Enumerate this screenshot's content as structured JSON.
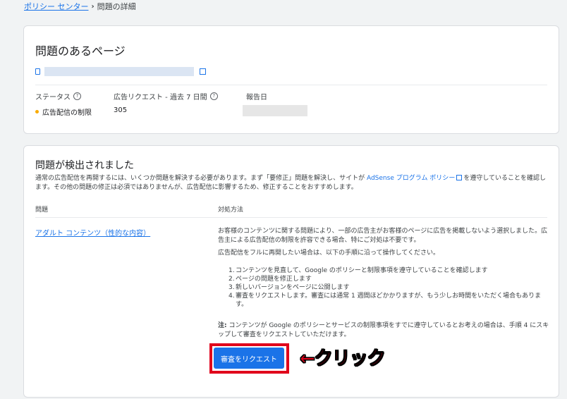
{
  "breadcrumb": {
    "link": "ポリシー センター",
    "separator": "›",
    "current": "問題の詳細"
  },
  "page_card": {
    "title": "問題のあるページ",
    "status_label": "ステータス",
    "requests_label": "広告リクエスト - 過去 7 日間",
    "report_date_label": "報告日",
    "status_value": "広告配信の制限",
    "requests_value": "305",
    "status_color": "#f9ab00"
  },
  "issues_card": {
    "title": "問題が検出されました",
    "intro_before": "通常の広告配信を再開するには、いくつか問題を解決する必要があります。まず「要修正」問題を解決し、サイトが ",
    "intro_link": "AdSense プログラム ポリシー",
    "intro_after": "を遵守していることを確認します。その他の問題の修正は必須ではありませんが、広告配信に影響するため、修正することをおすすめします。",
    "col_issue": "問題",
    "col_action": "対処方法",
    "issue_link": "アダルト コンテンツ（性的な内容）",
    "solution_p1": "お客様のコンテンツに関する問題により、一部の広告主がお客様のページに広告を掲載しないよう選択しました。広告主による広告配信の制限を許容できる場合、特にご対処は不要です。",
    "solution_p2": "広告配信をフルに再開したい場合は、以下の手順に沿って操作してください。",
    "steps": [
      {
        "num": "1.",
        "text": "コンテンツを見直して、Google のポリシーと制限事項を遵守していることを確認します"
      },
      {
        "num": "2.",
        "text": "ページの問題を修正します"
      },
      {
        "num": "3.",
        "text": "新しいバージョンをページに公開します"
      },
      {
        "num": "4.",
        "text": "審査をリクエストします。審査には通常 1 週間ほどかかりますが、もう少しお時間をいただく場合もあります。"
      }
    ],
    "note_label": "注:",
    "note_text": " コンテンツが Google のポリシーとサービスの制限事項をすでに遵守しているとお考えの場合は、手順 4 にスキップして審査をリクエストしていただけます。",
    "review_button": "審査をリクエスト"
  },
  "annotation": {
    "text": "←クリック",
    "color": "#e0001b"
  }
}
